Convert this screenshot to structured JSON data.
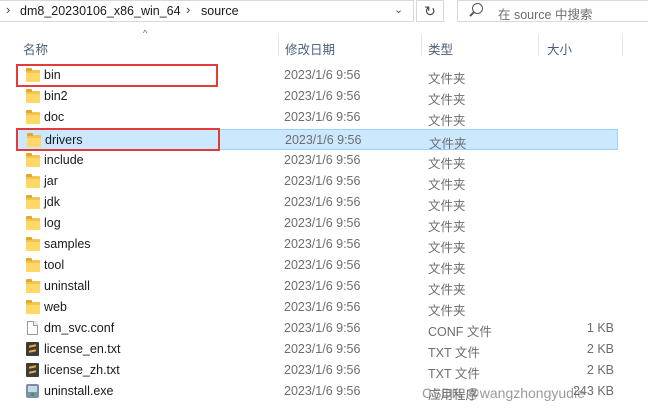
{
  "address_bar": {
    "crumbs": [
      "dm8_20230106_x86_win_64",
      "source"
    ],
    "search_placeholder": "在 source 中搜索"
  },
  "columns": {
    "name": "名称",
    "date": "修改日期",
    "type": "类型",
    "size": "大小"
  },
  "files": [
    {
      "name": "bin",
      "date": "2023/1/6 9:56",
      "type": "文件夹",
      "size": "",
      "icon": "folder"
    },
    {
      "name": "bin2",
      "date": "2023/1/6 9:56",
      "type": "文件夹",
      "size": "",
      "icon": "folder"
    },
    {
      "name": "doc",
      "date": "2023/1/6 9:56",
      "type": "文件夹",
      "size": "",
      "icon": "folder"
    },
    {
      "name": "drivers",
      "date": "2023/1/6 9:56",
      "type": "文件夹",
      "size": "",
      "icon": "folder"
    },
    {
      "name": "include",
      "date": "2023/1/6 9:56",
      "type": "文件夹",
      "size": "",
      "icon": "folder"
    },
    {
      "name": "jar",
      "date": "2023/1/6 9:56",
      "type": "文件夹",
      "size": "",
      "icon": "folder"
    },
    {
      "name": "jdk",
      "date": "2023/1/6 9:56",
      "type": "文件夹",
      "size": "",
      "icon": "folder"
    },
    {
      "name": "log",
      "date": "2023/1/6 9:56",
      "type": "文件夹",
      "size": "",
      "icon": "folder"
    },
    {
      "name": "samples",
      "date": "2023/1/6 9:56",
      "type": "文件夹",
      "size": "",
      "icon": "folder"
    },
    {
      "name": "tool",
      "date": "2023/1/6 9:56",
      "type": "文件夹",
      "size": "",
      "icon": "folder"
    },
    {
      "name": "uninstall",
      "date": "2023/1/6 9:56",
      "type": "文件夹",
      "size": "",
      "icon": "folder"
    },
    {
      "name": "web",
      "date": "2023/1/6 9:56",
      "type": "文件夹",
      "size": "",
      "icon": "folder"
    },
    {
      "name": "dm_svc.conf",
      "date": "2023/1/6 9:56",
      "type": "CONF 文件",
      "size": "1 KB",
      "icon": "file"
    },
    {
      "name": "license_en.txt",
      "date": "2023/1/6 9:56",
      "type": "TXT 文件",
      "size": "2 KB",
      "icon": "sublime"
    },
    {
      "name": "license_zh.txt",
      "date": "2023/1/6 9:56",
      "type": "TXT 文件",
      "size": "2 KB",
      "icon": "sublime"
    },
    {
      "name": "uninstall.exe",
      "date": "2023/1/6 9:56",
      "type": "应用程序",
      "size": "243 KB",
      "icon": "exe"
    }
  ],
  "watermark": "CSDN @wangzhongyudie",
  "colors": {
    "selection": "#cce8ff",
    "highlight_box": "#e23b3b"
  }
}
